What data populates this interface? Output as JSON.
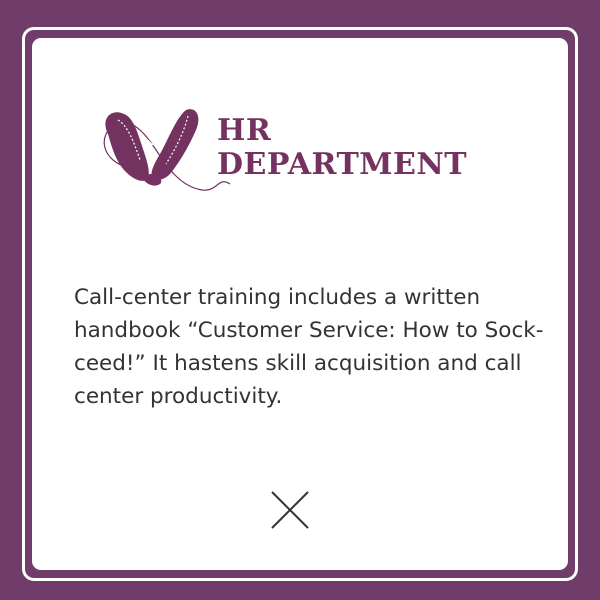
{
  "card": {
    "title_line1": "HR",
    "title_line2": "DEPARTMENT",
    "message": "Call-center training includes a written handbook “Customer Service: How to Sock-ceed!” It hastens skill acquisition and call center productivity."
  },
  "icons": {
    "logo": "sock-heart-logo-icon",
    "close": "close-icon"
  },
  "colors": {
    "background": "#703d6b",
    "accent": "#73325f",
    "card": "#ffffff",
    "text": "#333333"
  }
}
